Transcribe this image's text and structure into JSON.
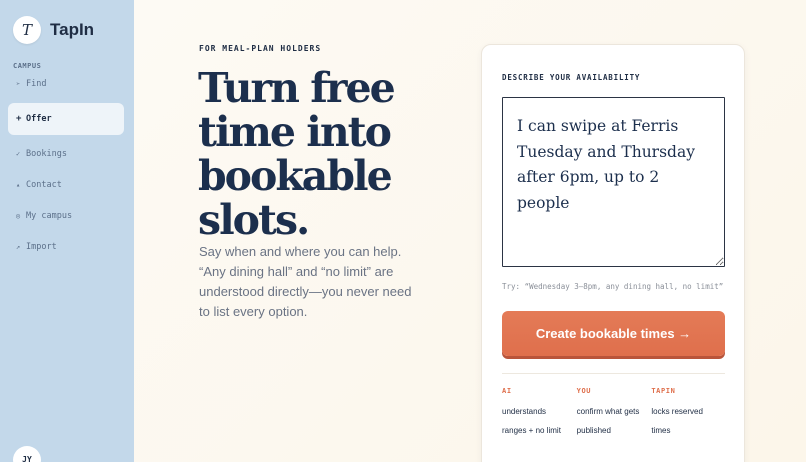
{
  "app": {
    "logo_letter": "T",
    "name": "TapIn"
  },
  "sidebar": {
    "section_label": "CAMPUS",
    "items": [
      {
        "icon": "arrow-icon",
        "glyph": "➢",
        "label": "Find"
      },
      {
        "icon": "plus-icon",
        "glyph": "+",
        "label": "Offer"
      },
      {
        "icon": "check-icon",
        "glyph": "✓",
        "label": "Bookings"
      },
      {
        "icon": "triangle-icon",
        "glyph": "▴",
        "label": "Contact"
      },
      {
        "icon": "globe-icon",
        "glyph": "◎",
        "label": "My campus"
      },
      {
        "icon": "diagonal-arrow-icon",
        "glyph": "↗",
        "label": "Import"
      }
    ],
    "active_item": "Offer",
    "avatar_initials": "JY"
  },
  "main": {
    "eyebrow": "FOR MEAL-PLAN HOLDERS",
    "headline": [
      "Turn free",
      "time into",
      "bookable",
      "slots."
    ],
    "lede": "Say when and where you can help. “Any dining hall” and “no limit” are understood directly—you never need to list every option."
  },
  "card": {
    "label": "DESCRIBE YOUR AVAILABILITY",
    "availability_value": "I can swipe at Ferris Tuesday and Thursday after 6pm, up to 2 people",
    "hint": "Try: “Wednesday 3–8pm, any dining hall, no limit”",
    "cta_label": "Create bookable times →",
    "steps": [
      {
        "title": "AI",
        "lines": [
          "understands",
          "ranges + no limit"
        ]
      },
      {
        "title": "YOU",
        "lines": [
          "confirm what gets",
          "published"
        ]
      },
      {
        "title": "TAPIN",
        "lines": [
          "locks reserved",
          "times"
        ]
      }
    ]
  },
  "colors": {
    "sidebar_bg": "#c3d8ea",
    "accent": "#df6f4c",
    "ink": "#1c2f4d",
    "page_bg": "#fdf9f1"
  }
}
